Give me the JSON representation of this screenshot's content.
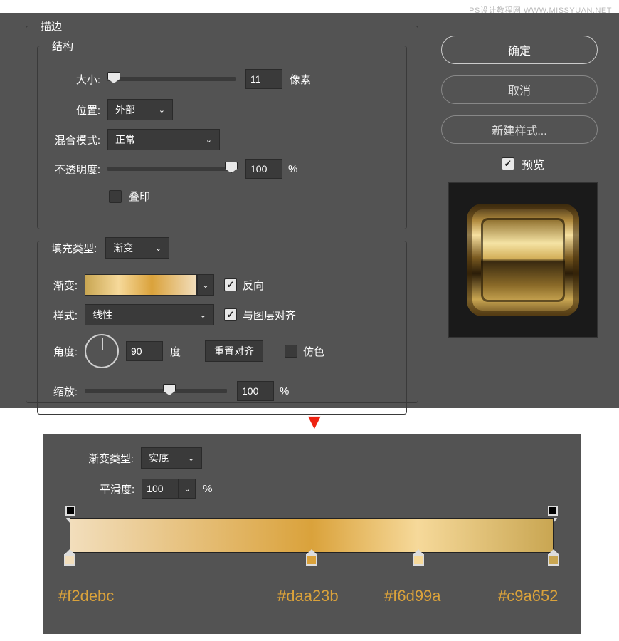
{
  "watermark": "PS设计教程网  WWW.MISSYUAN.NET",
  "stroke": {
    "title": "描边",
    "structure": {
      "title": "结构",
      "size_label": "大小:",
      "size_value": "11",
      "size_unit": "像素",
      "position_label": "位置:",
      "position_value": "外部",
      "blend_label": "混合模式:",
      "blend_value": "正常",
      "opacity_label": "不透明度:",
      "opacity_value": "100",
      "opacity_unit": "%",
      "overprint_label": "叠印"
    },
    "fill": {
      "title_label": "填充类型:",
      "title_value": "渐变",
      "grad_label": "渐变:",
      "reverse_label": "反向",
      "style_label": "样式:",
      "style_value": "线性",
      "align_label": "与图层对齐",
      "angle_label": "角度:",
      "angle_value": "90",
      "angle_unit": "度",
      "reset_label": "重置对齐",
      "dither_label": "仿色",
      "scale_label": "缩放:",
      "scale_value": "100",
      "scale_unit": "%"
    }
  },
  "buttons": {
    "ok": "确定",
    "cancel": "取消",
    "new_style": "新建样式...",
    "preview": "预览"
  },
  "grad_editor": {
    "type_label": "渐变类型:",
    "type_value": "实底",
    "smooth_label": "平滑度:",
    "smooth_value": "100",
    "smooth_unit": "%",
    "stops": [
      {
        "pos": 0,
        "hex": "#f2debc"
      },
      {
        "pos": 50,
        "hex": "#daa23b"
      },
      {
        "pos": 72,
        "hex": "#f6d99a"
      },
      {
        "pos": 100,
        "hex": "#c9a652"
      }
    ]
  }
}
